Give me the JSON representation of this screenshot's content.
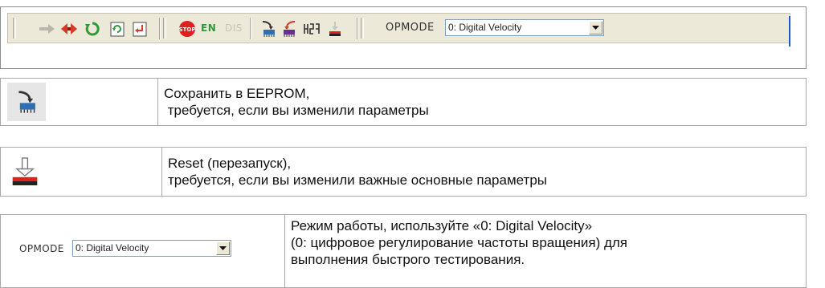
{
  "toolbar": {
    "buttons": [
      {
        "name": "arrow-right-icon",
        "interactable": true
      },
      {
        "name": "arrows-out-icon",
        "interactable": true
      },
      {
        "name": "refresh-icon",
        "interactable": true
      },
      {
        "name": "rotate-page-icon",
        "interactable": true
      },
      {
        "name": "enter-page-icon",
        "interactable": true
      },
      {
        "name": "stop-icon",
        "interactable": true
      },
      {
        "name": "save-eeprom-icon",
        "interactable": true
      },
      {
        "name": "load-parameters-icon",
        "interactable": true
      },
      {
        "name": "settings-icon",
        "interactable": true
      },
      {
        "name": "reset-icon",
        "interactable": true
      }
    ],
    "en_label": "EN",
    "dis_label": "DIS",
    "opmode_label": "OPMODE",
    "opmode_value": "0: Digital Velocity",
    "stop_text": "STOP"
  },
  "rows": [
    {
      "icon": "save-eeprom-icon",
      "lines": [
        "Сохранить в EEPROM,",
        " требуется, если вы изменили параметры"
      ]
    },
    {
      "icon": "reset-icon",
      "lines": [
        "Reset (перезапуск),",
        "требуется, если вы изменили важные основные параметры"
      ]
    },
    {
      "opmode_label": "OPMODE",
      "opmode_value": "0: Digital Velocity",
      "lines": [
        "Режим работы, используйте «0: Digital Velocity»",
        "(0: цифровое регулирование частоты вращения) для",
        "выполнения быстрого тестирования."
      ]
    }
  ],
  "colors": {
    "toolbar_bg": "#ece9d8",
    "en_green": "#2d9a3a",
    "accent_blue": "#2156c9"
  }
}
